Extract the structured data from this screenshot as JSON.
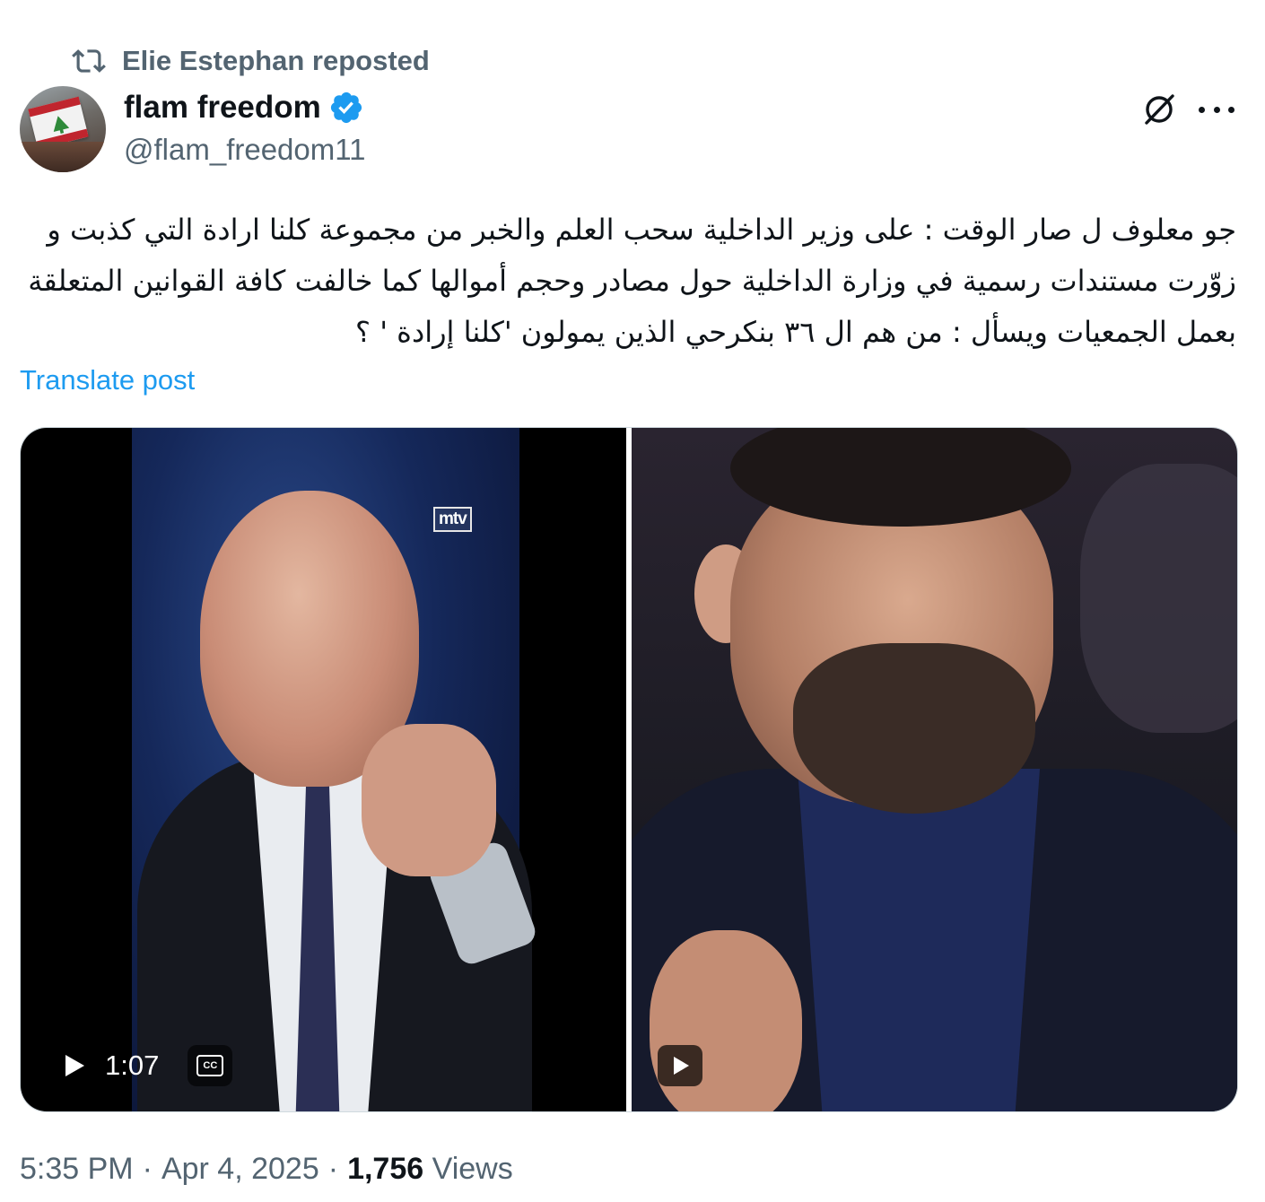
{
  "repost": {
    "icon": "repost-icon",
    "label": "Elie Estephan reposted"
  },
  "author": {
    "name": "flam freedom",
    "handle": "@flam_freedom11",
    "verified_icon": "verified-badge-icon",
    "avatar": "avatar"
  },
  "post": {
    "text": "جو معلوف ل صار الوقت : على وزير الداخلية سحب العلم والخبر من مجموعة كلنا ارادة التي كذبت و زوّرت مستندات رسمية في وزارة الداخلية حول مصادر وحجم أموالها كما خالفت كافة القوانين المتعلقة بعمل الجمعيات ويسأل : من هم ال ٣٦ بنكرحي الذين يمولون 'كلنا إرادة ' ؟",
    "translate_label": "Translate post"
  },
  "media": {
    "watermark": "mtv",
    "duration": "1:07",
    "cc_label": "CC"
  },
  "meta": {
    "time": "5:35 PM",
    "date": "Apr 4, 2025",
    "separator": "·",
    "views_count": "1,756",
    "views_label": "Views"
  },
  "colors": {
    "link": "#1d9bf0",
    "verified": "#1d9bf0",
    "secondary_text": "#536471",
    "primary_text": "#0f1419"
  }
}
